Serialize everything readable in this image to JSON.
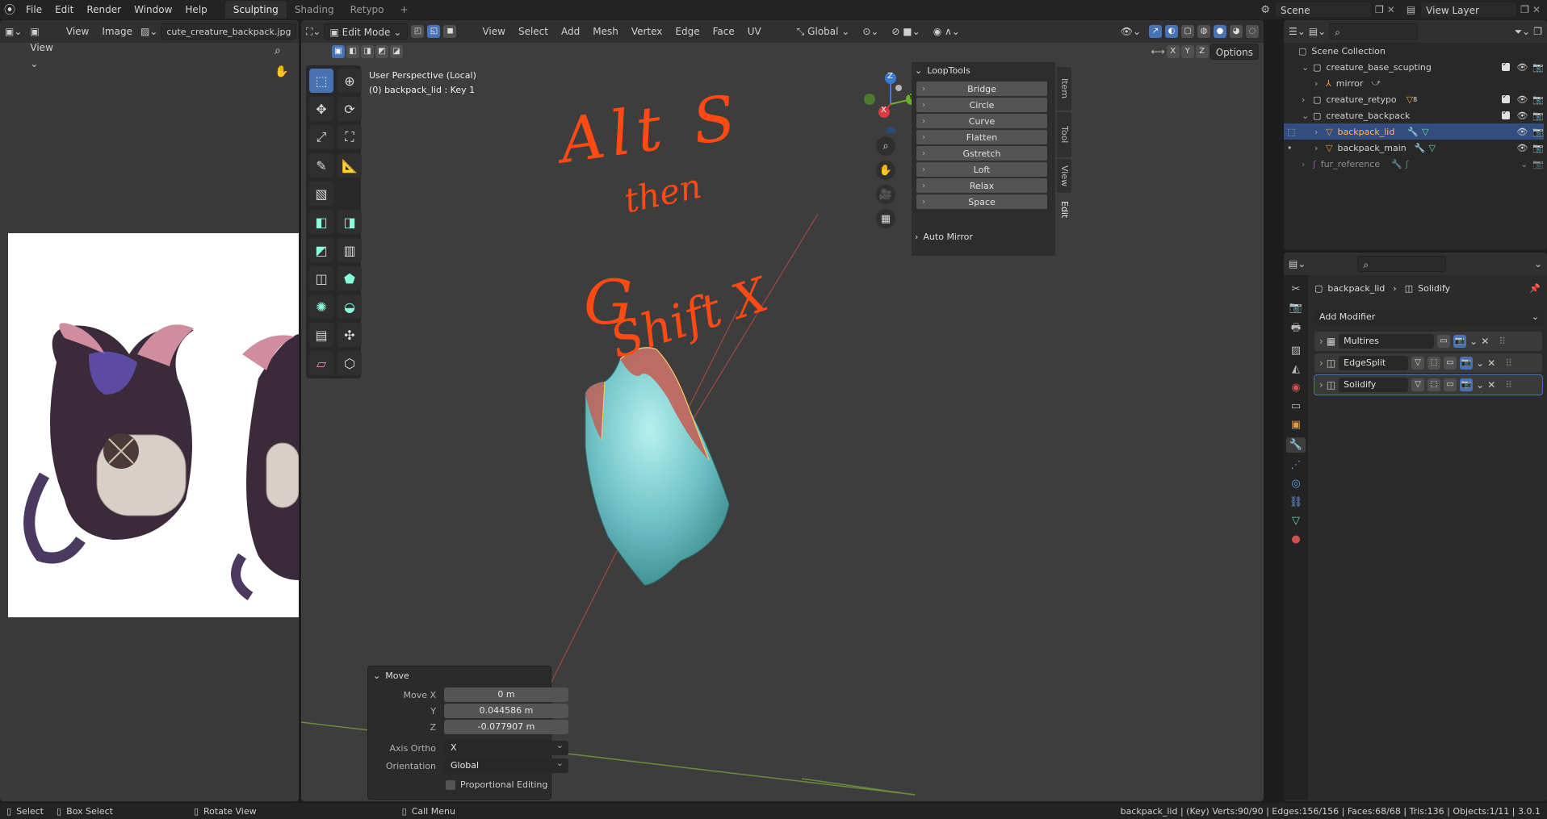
{
  "topbar": {
    "menus": [
      "File",
      "Edit",
      "Render",
      "Window",
      "Help"
    ],
    "workspaces": [
      "Sculpting",
      "Shading",
      "Retypo"
    ],
    "active_workspace": "Sculpting",
    "add_tab": "+",
    "scene": "Scene",
    "view_layer": "View Layer"
  },
  "image_editor": {
    "view_menu": "View",
    "view2": "View",
    "image_menu": "Image",
    "filename": "cute_creature_backpack.jpg"
  },
  "viewport": {
    "mode": "Edit Mode",
    "menus": [
      "View",
      "Select",
      "Add",
      "Mesh",
      "Vertex",
      "Edge",
      "Face",
      "UV"
    ],
    "orientation": "Global",
    "axes": [
      "X",
      "Y",
      "Z"
    ],
    "options": "Options",
    "info_line1": "User Perspective (Local)",
    "info_line2": "(0) backpack_lid : Key 1",
    "gizmo_z": "Z",
    "gizmo_y": "Y",
    "gizmo_x": "X"
  },
  "annotations": {
    "line1": "Alt S",
    "line2": "then",
    "line3": "G",
    "line4": "Shift X",
    "color": "#ff4a14"
  },
  "loop_tools": {
    "title": "LoopTools",
    "items": [
      "Bridge",
      "Circle",
      "Curve",
      "Flatten",
      "Gstretch",
      "Loft",
      "Relax",
      "Space"
    ],
    "auto_mirror": "Auto Mirror"
  },
  "side_tabs": [
    "Item",
    "Tool",
    "View",
    "Edit"
  ],
  "move_panel": {
    "title": "Move",
    "move_x_label": "Move X",
    "move_x": "0 m",
    "y_label": "Y",
    "y": "0.044586 m",
    "z_label": "Z",
    "z": "-0.077907 m",
    "axis_ortho_label": "Axis Ortho",
    "axis_ortho": "X",
    "orientation_label": "Orientation",
    "orientation": "Global",
    "proportional": "Proportional Editing"
  },
  "outliner": {
    "root": "Scene Collection",
    "rows": [
      {
        "name": "creature_base_scupting"
      },
      {
        "name": "mirror"
      },
      {
        "name": "creature_retypo"
      },
      {
        "name": "creature_backpack"
      },
      {
        "name": "backpack_lid"
      },
      {
        "name": "backpack_main"
      },
      {
        "name": "fur_reference"
      }
    ],
    "retypo_badge": "8"
  },
  "properties": {
    "breadcrumb_object": "backpack_lid",
    "breadcrumb_modifier": "Solidify",
    "add_modifier": "Add Modifier",
    "modifiers": [
      "Multires",
      "EdgeSplit",
      "Solidify"
    ]
  },
  "statusbar": {
    "select": "Select",
    "box_select": "Box Select",
    "rotate_view": "Rotate View",
    "call_menu": "Call Menu",
    "stats": "backpack_lid | (Key) Verts:90/90 | Edges:156/156 | Faces:68/68 | Tris:136 | Objects:1/11 | 3.0.1"
  }
}
